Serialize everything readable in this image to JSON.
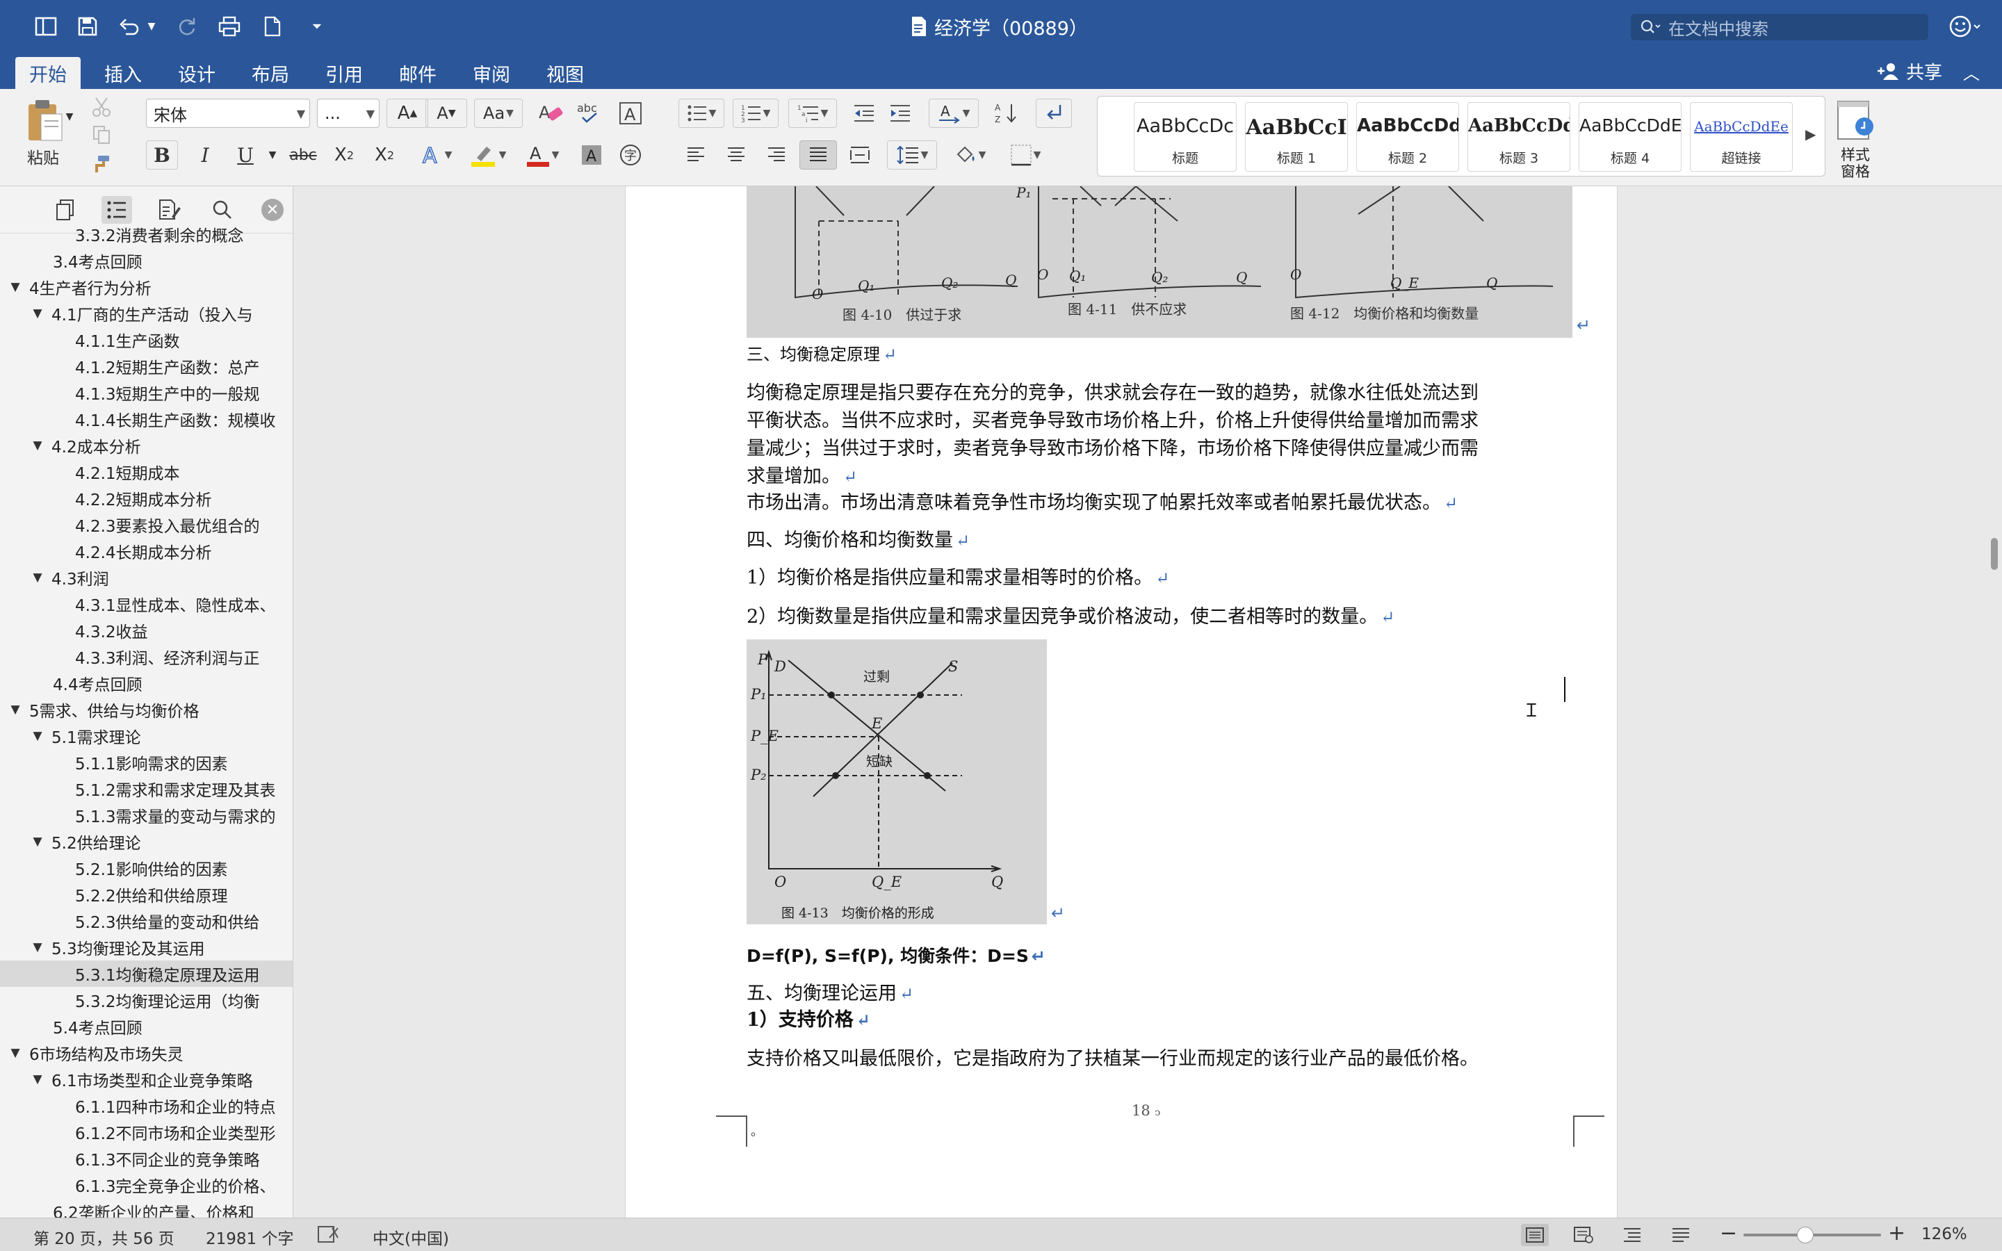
{
  "titlebar": {
    "title": "经济学（00889）",
    "search_placeholder": "在文档中搜索"
  },
  "ribbon_tabs": [
    "开始",
    "插入",
    "设计",
    "布局",
    "引用",
    "邮件",
    "审阅",
    "视图"
  ],
  "share_label": "共享",
  "ribbon": {
    "paste_label": "粘贴",
    "font_name": "宋体",
    "font_size": "...",
    "style_pane_label": "样式\n窗格",
    "styles": [
      {
        "sample": "AaBbCcDc",
        "name": "标题"
      },
      {
        "sample": "AaBbCcI",
        "name": "标题 1"
      },
      {
        "sample": "AaBbCcDdI",
        "name": "标题 2"
      },
      {
        "sample": "AaBbCcDd",
        "name": "标题 3"
      },
      {
        "sample": "AaBbCcDdE",
        "name": "标题 4"
      },
      {
        "sample": "AaBbCcDdEe",
        "name": "超链接"
      }
    ]
  },
  "outline": [
    {
      "text": "3.3.2消费者剩余的概念",
      "level": 3,
      "expanded": null,
      "selected": false
    },
    {
      "text": "3.4考点回顾",
      "level": 2,
      "expanded": null,
      "selected": false
    },
    {
      "text": "4生产者行为分析",
      "level": 1,
      "expanded": true,
      "selected": false
    },
    {
      "text": "4.1厂商的生产活动（投入与",
      "level": 2,
      "expanded": true,
      "selected": false
    },
    {
      "text": "4.1.1生产函数",
      "level": 3,
      "expanded": null,
      "selected": false
    },
    {
      "text": "4.1.2短期生产函数：总产",
      "level": 3,
      "expanded": null,
      "selected": false
    },
    {
      "text": "4.1.3短期生产中的一般规",
      "level": 3,
      "expanded": null,
      "selected": false
    },
    {
      "text": "4.1.4长期生产函数：规模收",
      "level": 3,
      "expanded": null,
      "selected": false
    },
    {
      "text": "4.2成本分析",
      "level": 2,
      "expanded": true,
      "selected": false
    },
    {
      "text": "4.2.1短期成本",
      "level": 3,
      "expanded": null,
      "selected": false
    },
    {
      "text": "4.2.2短期成本分析",
      "level": 3,
      "expanded": null,
      "selected": false
    },
    {
      "text": "4.2.3要素投入最优组合的",
      "level": 3,
      "expanded": null,
      "selected": false
    },
    {
      "text": "4.2.4长期成本分析",
      "level": 3,
      "expanded": null,
      "selected": false
    },
    {
      "text": "4.3利润",
      "level": 2,
      "expanded": true,
      "selected": false
    },
    {
      "text": "4.3.1显性成本、隐性成本、",
      "level": 3,
      "expanded": null,
      "selected": false
    },
    {
      "text": "4.3.2收益",
      "level": 3,
      "expanded": null,
      "selected": false
    },
    {
      "text": "4.3.3利润、经济利润与正",
      "level": 3,
      "expanded": null,
      "selected": false
    },
    {
      "text": "4.4考点回顾",
      "level": 2,
      "expanded": null,
      "selected": false
    },
    {
      "text": "5需求、供给与均衡价格",
      "level": 1,
      "expanded": true,
      "selected": false
    },
    {
      "text": "5.1需求理论",
      "level": 2,
      "expanded": true,
      "selected": false
    },
    {
      "text": "5.1.1影响需求的因素",
      "level": 3,
      "expanded": null,
      "selected": false
    },
    {
      "text": "5.1.2需求和需求定理及其表",
      "level": 3,
      "expanded": null,
      "selected": false
    },
    {
      "text": "5.1.3需求量的变动与需求的",
      "level": 3,
      "expanded": null,
      "selected": false
    },
    {
      "text": "5.2供给理论",
      "level": 2,
      "expanded": true,
      "selected": false
    },
    {
      "text": "5.2.1影响供给的因素",
      "level": 3,
      "expanded": null,
      "selected": false
    },
    {
      "text": "5.2.2供给和供给原理",
      "level": 3,
      "expanded": null,
      "selected": false
    },
    {
      "text": "5.2.3供给量的变动和供给",
      "level": 3,
      "expanded": null,
      "selected": false
    },
    {
      "text": "5.3均衡理论及其运用",
      "level": 2,
      "expanded": true,
      "selected": false
    },
    {
      "text": "5.3.1均衡稳定原理及运用",
      "level": 3,
      "expanded": null,
      "selected": true
    },
    {
      "text": "5.3.2均衡理论运用（均衡",
      "level": 3,
      "expanded": null,
      "selected": false
    },
    {
      "text": "5.4考点回顾",
      "level": 2,
      "expanded": null,
      "selected": false
    },
    {
      "text": "6市场结构及市场失灵",
      "level": 1,
      "expanded": true,
      "selected": false
    },
    {
      "text": "6.1市场类型和企业竞争策略",
      "level": 2,
      "expanded": true,
      "selected": false
    },
    {
      "text": "6.1.1四种市场和企业的特点",
      "level": 3,
      "expanded": null,
      "selected": false
    },
    {
      "text": "6.1.2不同市场和企业类型形",
      "level": 3,
      "expanded": null,
      "selected": false
    },
    {
      "text": "6.1.3不同企业的竞争策略",
      "level": 3,
      "expanded": null,
      "selected": false
    },
    {
      "text": "6.1.3完全竞争企业的价格、",
      "level": 3,
      "expanded": null,
      "selected": false
    },
    {
      "text": "6.2垄断企业的产量、价格和",
      "level": 2,
      "expanded": null,
      "selected": false
    }
  ],
  "document": {
    "fig_top_captions": [
      "图 4-10　供过于求",
      "图 4-11　供不应求",
      "图 4-12　均衡价格和均衡数量"
    ],
    "fig_top_labels": {
      "O": "O",
      "Q1": "Q₁",
      "Q2": "Q₂",
      "Q": "Q",
      "P1": "P₁",
      "QE": "Q_E"
    },
    "heading3": "三、均衡稳定原理",
    "para1": [
      "均衡稳定原理是指只要存在充分的竞争，供求就会存在一致的趋势，就像水往低处流达到",
      "平衡状态。当供不应求时，买者竞争导致市场价格上升，价格上升使得供给量增加而需求",
      "量减少；当供过于求时，卖者竞争导致市场价格下降，市场价格下降使得供应量减少而需",
      "求量增加。"
    ],
    "para2": "市场出清。市场出清意味着竞争性市场均衡实现了帕累托效率或者帕累托最优状态。",
    "heading4": "四、均衡价格和均衡数量",
    "item1": "1）均衡价格是指供应量和需求量相等时的价格。",
    "item2": "2）均衡数量是指供应量和需求量因竞争或价格波动，使二者相等时的数量。",
    "fig413": {
      "caption": "图 4-13　均衡价格的形成",
      "P": "P",
      "P1": "P₁",
      "PE": "P_E",
      "P2": "P₂",
      "O": "O",
      "QE": "Q_E",
      "Q": "Q",
      "D": "D",
      "S": "S",
      "E": "E",
      "surplus": "过剩",
      "shortage": "短缺"
    },
    "formula": "D=f(P), S=f(P),  均衡条件：D=S",
    "heading5": "五、均衡理论运用",
    "item_support": "1）支持价格",
    "para3": "支持价格又叫最低限价，它是指政府为了扶植某一行业而规定的该行业产品的最低价格。",
    "page_number": "18",
    "paragraph_mark": "↵",
    "page_end_mark": "。"
  },
  "status": {
    "page": "第 20 页，共 56 页",
    "words": "21981 个字",
    "language": "中文(中国)",
    "zoom": "126%",
    "zoom_level_fraction": 0.45
  },
  "colors": {
    "title_blue": "#2b579a",
    "paragraph_mark": "#3f6fb5",
    "font_color_red": "#d42a1f",
    "highlight_yellow": "#f5e000"
  }
}
